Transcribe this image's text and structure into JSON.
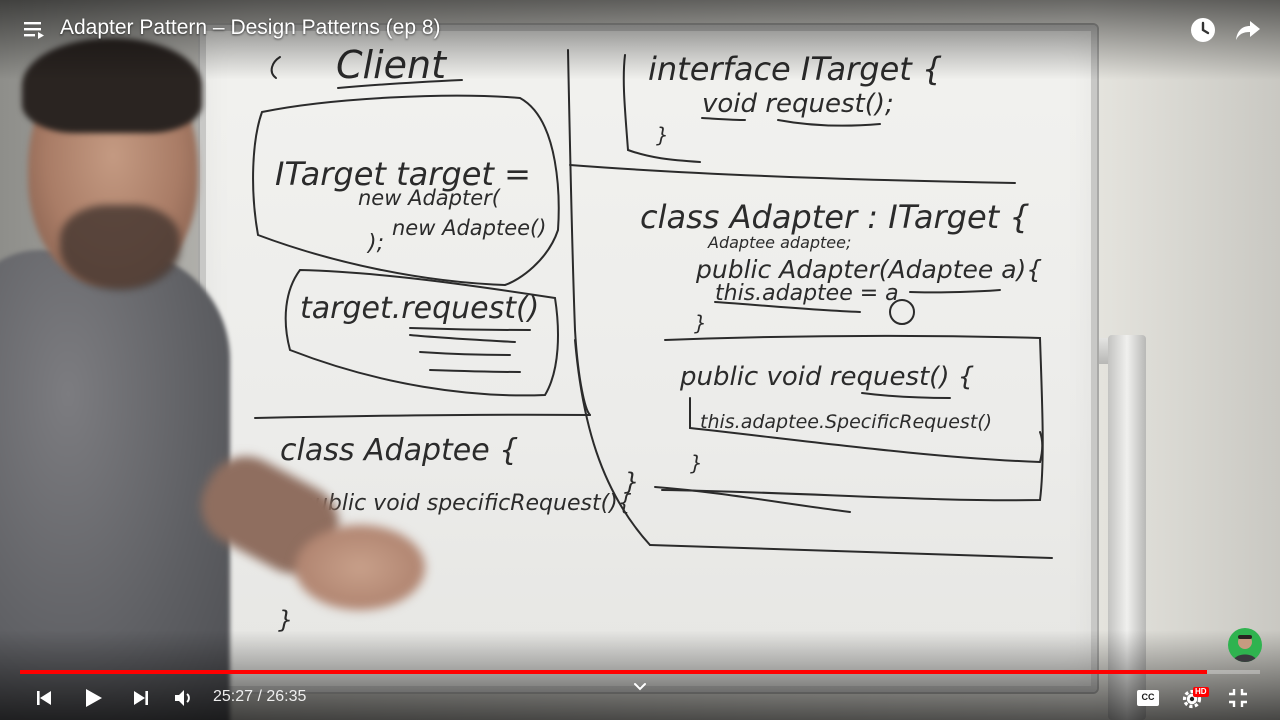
{
  "header": {
    "video_title": "Adapter Pattern – Design Patterns (ep 8)",
    "menu_icon": "playlist-menu-icon",
    "watch_later_icon": "clock-icon",
    "share_icon": "share-arrow-icon"
  },
  "whiteboard": {
    "client_heading": "Client",
    "client_code": [
      "ITarget target =",
      "new Adapter(",
      "new Adaptee()",
      ");"
    ],
    "client_call": "target.request()",
    "interface_code": [
      "interface ITarget {",
      "void request();",
      "}"
    ],
    "adapter_code": [
      "class Adapter : ITarget {",
      "Adaptee adaptee;",
      "public Adapter(Adaptee a){",
      "this.adaptee = a",
      "}",
      "public void request() {",
      "this.adaptee.SpecificRequest()",
      "}",
      "}"
    ],
    "adaptee_code": [
      "class Adaptee {",
      "public void specificRequest(){",
      "}"
    ]
  },
  "player": {
    "current_time": "25:27",
    "duration": "26:35",
    "time_display": "25:27 / 26:35",
    "progress_fraction": 0.957,
    "progress_color": "#ff0000",
    "cc_label": "CC",
    "hd_badge": "HD",
    "icons": {
      "previous": "skip-previous-icon",
      "play": "play-icon",
      "next": "skip-next-icon",
      "volume": "volume-icon",
      "chevron": "chevron-down-icon",
      "captions": "closed-captions-icon",
      "settings": "gear-icon",
      "exit_fullscreen": "exit-fullscreen-icon",
      "channel_avatar": "channel-avatar-icon"
    }
  }
}
